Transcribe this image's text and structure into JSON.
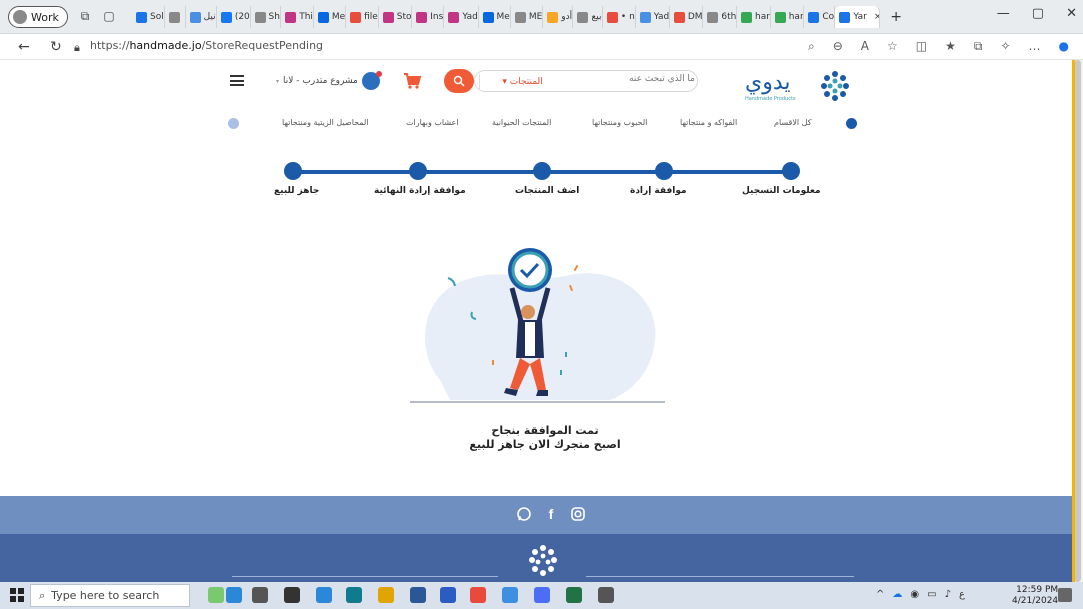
{
  "browser": {
    "profile_label": "Work",
    "tabs": [
      {
        "label": "Sol",
        "color": "#1b73e8"
      },
      {
        "label": "",
        "color": "#888888"
      },
      {
        "label": "نيل",
        "color": "#4a90e2"
      },
      {
        "label": "(20",
        "color": "#1877f2"
      },
      {
        "label": "Sh",
        "color": "#888888"
      },
      {
        "label": "Thi",
        "color": "#c13584"
      },
      {
        "label": "Me",
        "color": "#0668e1"
      },
      {
        "label": "file",
        "color": "#e74c3c"
      },
      {
        "label": "Sto",
        "color": "#c13584"
      },
      {
        "label": "Ins",
        "color": "#c13584"
      },
      {
        "label": "Yad",
        "color": "#c13584"
      },
      {
        "label": "Me",
        "color": "#0668e1"
      },
      {
        "label": "ME",
        "color": "#888888"
      },
      {
        "label": "أدو",
        "color": "#f5a623"
      },
      {
        "label": "بيع",
        "color": "#888888"
      },
      {
        "label": "• n",
        "color": "#e74c3c"
      },
      {
        "label": "Yad",
        "color": "#4a90e2"
      },
      {
        "label": "DM",
        "color": "#e74c3c"
      },
      {
        "label": "6th",
        "color": "#888888"
      },
      {
        "label": "har",
        "color": "#34a853"
      },
      {
        "label": "har",
        "color": "#34a853"
      },
      {
        "label": "Co",
        "color": "#1b73e8"
      },
      {
        "label": "Yar",
        "color": "#1b73e8"
      }
    ],
    "active_tab_close": "×",
    "new_tab": "+",
    "window_controls": [
      "—",
      "▢",
      "✕"
    ],
    "url_prefix": "https://",
    "url_host": "handmade.jo",
    "url_path": "/StoreRequestPending"
  },
  "header": {
    "logo_text": "يدوي",
    "logo_subtitle": "Handmade Products",
    "search_placeholder": "ما الذي تبحث عنه",
    "search_category": "المنتجات ▾",
    "user_label": "مشروع متدرب - لانا",
    "colors": {
      "primary": "#1a5aa8",
      "accent": "#ef5b36"
    }
  },
  "categories": [
    "كل الاقسام",
    "الفواكه و منتجاتها",
    "الحبوب ومنتجاتها",
    "المنتجات الحيوانية",
    "اعشاب وبهارات",
    "المحاصيل الزيتية ومنتجاتها"
  ],
  "stepper": {
    "steps": [
      "معلومات التسجيل",
      "موافقة إرادة",
      "اضف المنتجات",
      "موافقة إرادة النهائية",
      "جاهز للبيع"
    ]
  },
  "messages": {
    "line1": "تمت الموافقة بنجاح",
    "line2": "اصبح متجرك الان جاهز للبيع"
  },
  "footer": {
    "social_icons": [
      "whatsapp-icon",
      "facebook-icon",
      "instagram-icon"
    ]
  },
  "taskbar": {
    "search_placeholder": "Type here to search",
    "time": "12:59 PM",
    "date": "4/21/2024"
  }
}
